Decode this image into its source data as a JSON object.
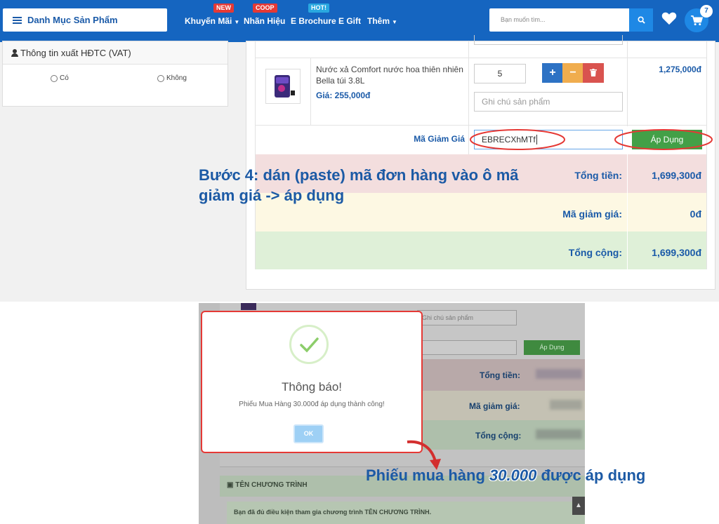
{
  "navbar": {
    "category_label": "Danh Mục Sản Phẩm",
    "items": [
      {
        "label": "Khuyến Mãi",
        "badge": "NEW",
        "has_caret": true
      },
      {
        "label": "Nhãn Hiệu",
        "badge": "COOP",
        "has_caret": false
      },
      {
        "label": "E Brochure",
        "badge": "HOT!",
        "has_caret": false
      },
      {
        "label": "E Gift",
        "badge": "",
        "has_caret": false
      },
      {
        "label": "Thêm",
        "badge": "",
        "has_caret": true
      }
    ],
    "search_placeholder": "Bạn muốn tìm...",
    "cart_count": "7",
    "colors": {
      "bar": "#1565c0",
      "accent": "#1e88e5",
      "badge_red": "#e53935",
      "badge_blue": "#29a8e0"
    }
  },
  "vat_panel": {
    "title": "Thông tin xuất HĐTC (VAT)",
    "options": [
      "Có",
      "Không"
    ]
  },
  "cart": {
    "product": {
      "name": "Nước xả Comfort nước hoa thiên nhiên Bella túi 3.8L",
      "price": "Giá: 255,000đ",
      "quantity": "5",
      "note_placeholder": "Ghi chú sản phẩm",
      "line_total": "1,275,000đ"
    },
    "coupon": {
      "label": "Mã Giảm Giá",
      "value": "EBRECXhMTf",
      "apply_label": "Áp Dụng"
    },
    "summary": [
      {
        "label": "Tổng tiền:",
        "value": "1,699,300đ",
        "bg": "#f3dede"
      },
      {
        "label": "Mã giảm giá:",
        "value": "0đ",
        "bg": "#fdf8e3"
      },
      {
        "label": "Tổng cộng:",
        "value": "1,699,300đ",
        "bg": "#dff0d8"
      }
    ]
  },
  "annotation_step": "Bước 4: dán (paste) mã đơn hàng vào ô mã giảm giá -> áp dụng",
  "screenshot2": {
    "note_placeholder": "Ghi chú sản phẩm",
    "apply_label": "Áp Dụng",
    "summary_labels": [
      "Tổng tiền:",
      "Mã giảm giá:",
      "Tổng cộng:"
    ],
    "program_title": "TÊN CHƯƠNG TRÌNH",
    "program_text": "Bạn đã đủ điều kiện tham gia chương trình TÊN CHƯƠNG TRÌNH.",
    "modal": {
      "title": "Thông báo!",
      "message": "Phiếu Mua Hàng 30.000đ áp dụng thành công!",
      "ok_label": "OK"
    }
  },
  "annotation_applied": {
    "before": "Phiếu mua hàng ",
    "highlight": "30.000",
    "after": " được áp dụng"
  }
}
